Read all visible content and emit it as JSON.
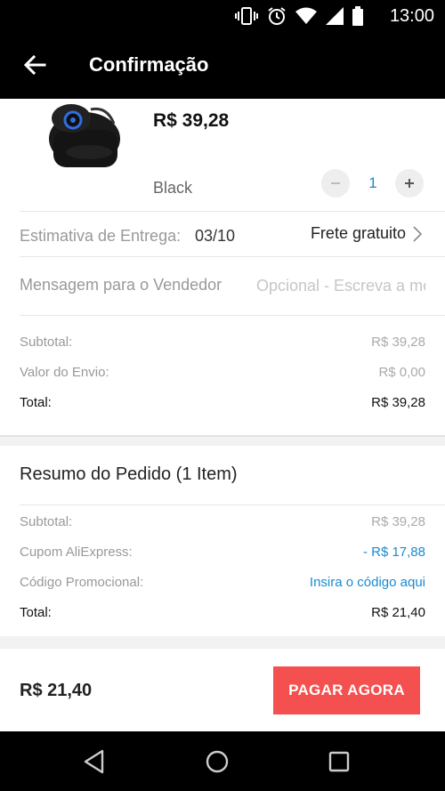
{
  "status_bar": {
    "time": "13:00",
    "icons": [
      "vibrate-icon",
      "alarm-icon",
      "wifi-icon",
      "signal-icon",
      "battery-icon"
    ]
  },
  "app_bar": {
    "title": "Confirmação",
    "back_icon": "arrow-left-icon"
  },
  "product": {
    "price": "R$ 39,28",
    "variant": "Black",
    "quantity": "1",
    "minus_symbol": "−",
    "plus_symbol": "+"
  },
  "delivery": {
    "label": "Estimativa de Entrega:",
    "date": "03/10",
    "shipping": "Frete gratuito"
  },
  "message": {
    "label": "Mensagem para o Vendedor",
    "placeholder": "Opcional - Escreva a mensagem",
    "value": ""
  },
  "store_summary": {
    "rows": [
      {
        "label": "Subtotal:",
        "value": "R$ 39,28"
      },
      {
        "label": "Valor do Envio:",
        "value": "R$ 0,00"
      }
    ],
    "total_label": "Total:",
    "total_value": "R$ 39,28"
  },
  "order_summary": {
    "title": "Resumo do Pedido (1 Item)",
    "subtotal_label": "Subtotal:",
    "subtotal_value": "R$ 39,28",
    "coupon_label": "Cupom AliExpress:",
    "coupon_value": "- R$ 17,88",
    "promo_label": "Código Promocional:",
    "promo_link": "Insira o código aqui",
    "total_label": "Total:",
    "total_value": "R$ 21,40"
  },
  "bottom_bar": {
    "total": "R$ 21,40",
    "pay_button": "PAGAR AGORA"
  },
  "colors": {
    "accent_blue": "#1a8ad1",
    "pay_button": "#f45050"
  }
}
